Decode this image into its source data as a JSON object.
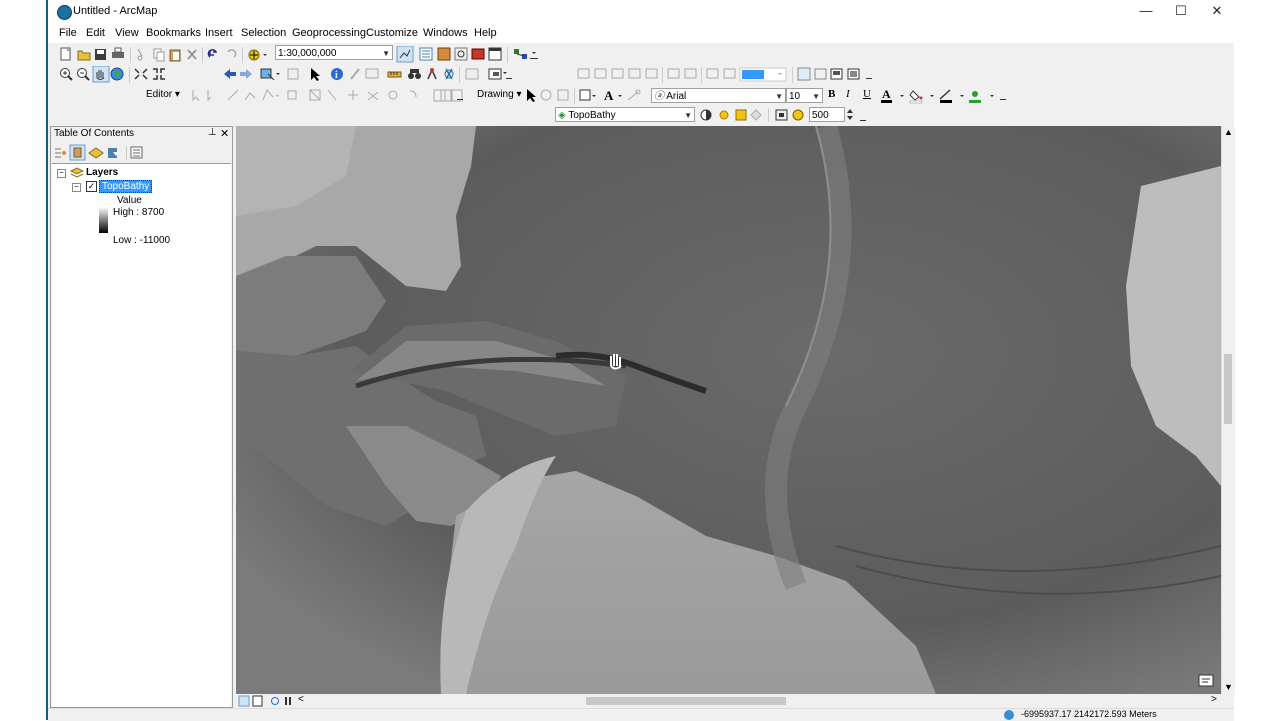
{
  "window": {
    "title": "Untitled - ArcMap",
    "minimize": "—",
    "maximize": "☐",
    "close": "✕"
  },
  "menu": [
    "File",
    "Edit",
    "View",
    "Bookmarks",
    "Insert",
    "Selection",
    "Geoprocessing",
    "Customize",
    "Windows",
    "Help"
  ],
  "standard_toolbar": {
    "scale": "1:30,000,000"
  },
  "editor_toolbar": {
    "label": "Editor"
  },
  "draw_toolbar": {
    "label": "Drawing",
    "font": "Arial",
    "font_size": "10",
    "bold": "B",
    "italic": "I",
    "underline": "U",
    "font_color_glyph": "A"
  },
  "effects_toolbar": {
    "layer": "TopoBathy",
    "contrast": "500"
  },
  "toc": {
    "title": "Table Of Contents",
    "pin": "ꟷ",
    "close": "✕",
    "root": "Layers",
    "layer": "TopoBathy",
    "legend_label": "Value",
    "high": "High : 8700",
    "low": "Low : -11000"
  },
  "status": {
    "coordinates": "-6995937.17  2142172.593 Meters"
  },
  "colors": {
    "accent": "#0f5f8c",
    "selection": "#3399ff"
  }
}
